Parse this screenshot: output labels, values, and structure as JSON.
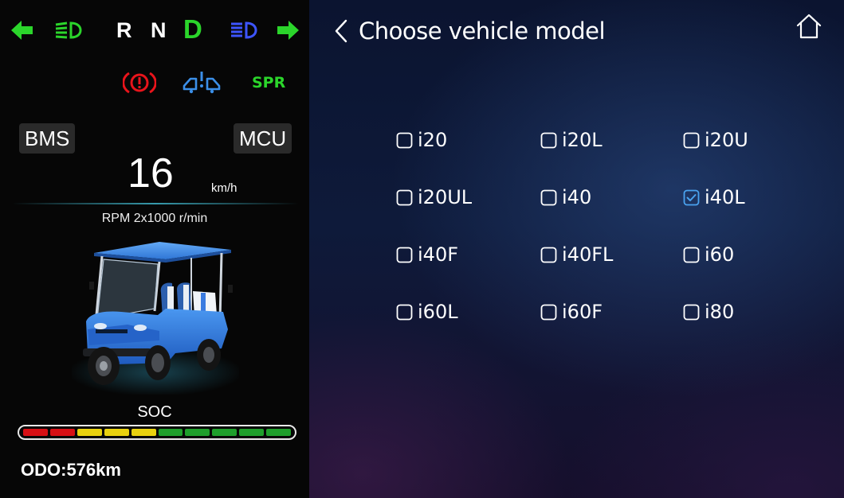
{
  "indicators": {
    "gears": [
      "R",
      "N",
      "D"
    ],
    "active_gear": "D",
    "left_turn_icon": "arrow-left-icon",
    "right_turn_icon": "arrow-right-icon",
    "low_beam_icon": "low-beam-icon",
    "high_beam_icon": "high-beam-icon"
  },
  "warnings": {
    "brake_icon": "parking-brake-icon",
    "system_icon": "car-lift-icon",
    "spr_label": "SPR"
  },
  "left_panel": {
    "bms_label": "BMS",
    "mcu_label": "MCU",
    "speed_value": "16",
    "speed_unit": "km/h",
    "rpm_label": "RPM 2x1000 r/min",
    "soc_label": "SOC",
    "soc_segments": [
      "#d60f14",
      "#d60f14",
      "#e8d10f",
      "#e8d10f",
      "#e8d10f",
      "#1e9e2b",
      "#1e9e2b",
      "#1e9e2b",
      "#1e9e2b",
      "#1e9e2b"
    ],
    "odo_label": "ODO:576km"
  },
  "colors": {
    "accent_green": "#2bd52b",
    "beam_blue": "#3d55ff",
    "warning_red": "#e8141b",
    "checkbox_checked": "#4aa3f0"
  },
  "header": {
    "title": "Choose vehicle model"
  },
  "models": [
    {
      "label": "i20",
      "checked": false
    },
    {
      "label": "i20L",
      "checked": false
    },
    {
      "label": "i20U",
      "checked": false
    },
    {
      "label": "i20UL",
      "checked": false
    },
    {
      "label": "i40",
      "checked": false
    },
    {
      "label": "i40L",
      "checked": true
    },
    {
      "label": "i40F",
      "checked": false
    },
    {
      "label": "i40FL",
      "checked": false
    },
    {
      "label": "i60",
      "checked": false
    },
    {
      "label": "i60L",
      "checked": false
    },
    {
      "label": "i60F",
      "checked": false
    },
    {
      "label": "i80",
      "checked": false
    }
  ]
}
